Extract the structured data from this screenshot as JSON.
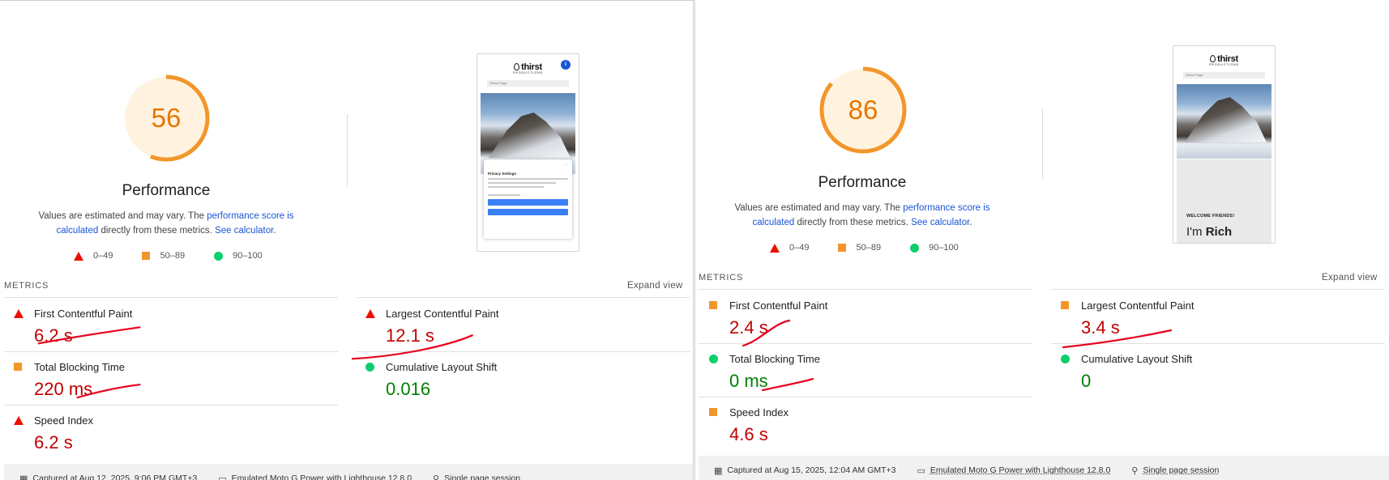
{
  "colors": {
    "fail": "#eb0f00",
    "average": "#f2962b",
    "pass": "#0cce6b",
    "gauge_bg": "#fff3e0",
    "link": "#1a56d6",
    "annotation": "#e8001c"
  },
  "shared": {
    "performance_title": "Performance",
    "desc_prefix": "Values are estimated and may vary. The ",
    "desc_link1": "performance score is calculated",
    "desc_middle": " directly from these metrics. ",
    "desc_link2": "See calculator",
    "desc_suffix": ".",
    "legend": [
      {
        "icon": "red-triangle-icon",
        "label": "0–49"
      },
      {
        "icon": "orange-square-icon",
        "label": "50–89"
      },
      {
        "icon": "green-circle-icon",
        "label": "90–100"
      }
    ],
    "metrics_heading": "METRICS",
    "expand_view": "Expand view",
    "mobile_preview": {
      "logo": "thirst",
      "logo_sub": "PRODUCTIONS",
      "select": "Select Page",
      "privacy_title": "Privacy Settings",
      "welcome": "WELCOME FRIENDS!",
      "name_prefix": "I'm ",
      "name_bold": "Rich"
    }
  },
  "left": {
    "score": 56,
    "metrics": {
      "fcp": {
        "title": "First Contentful Paint",
        "value": "6.2 s",
        "rating": "fail"
      },
      "lcp": {
        "title": "Largest Contentful Paint",
        "value": "12.1 s",
        "rating": "fail"
      },
      "tbt": {
        "title": "Total Blocking Time",
        "value": "220 ms",
        "rating": "average"
      },
      "cls": {
        "title": "Cumulative Layout Shift",
        "value": "0.016",
        "rating": "pass"
      },
      "si": {
        "title": "Speed Index",
        "value": "6.2 s",
        "rating": "fail"
      }
    },
    "footer": {
      "captured": "Captured at Aug 12, 2025, 9:06 PM GMT+3",
      "emulated": "Emulated Moto G Power with Lighthouse 12.8.0",
      "session": "Single page session"
    }
  },
  "right": {
    "score": 86,
    "metrics": {
      "fcp": {
        "title": "First Contentful Paint",
        "value": "2.4 s",
        "rating": "average"
      },
      "lcp": {
        "title": "Largest Contentful Paint",
        "value": "3.4 s",
        "rating": "average"
      },
      "tbt": {
        "title": "Total Blocking Time",
        "value": "0 ms",
        "rating": "pass"
      },
      "cls": {
        "title": "Cumulative Layout Shift",
        "value": "0",
        "rating": "pass"
      },
      "si": {
        "title": "Speed Index",
        "value": "4.6 s",
        "rating": "average"
      }
    },
    "footer": {
      "captured": "Captured at Aug 15, 2025, 12:04 AM GMT+3",
      "emulated": "Emulated Moto G Power with Lighthouse 12.8.0",
      "session": "Single page session"
    }
  }
}
